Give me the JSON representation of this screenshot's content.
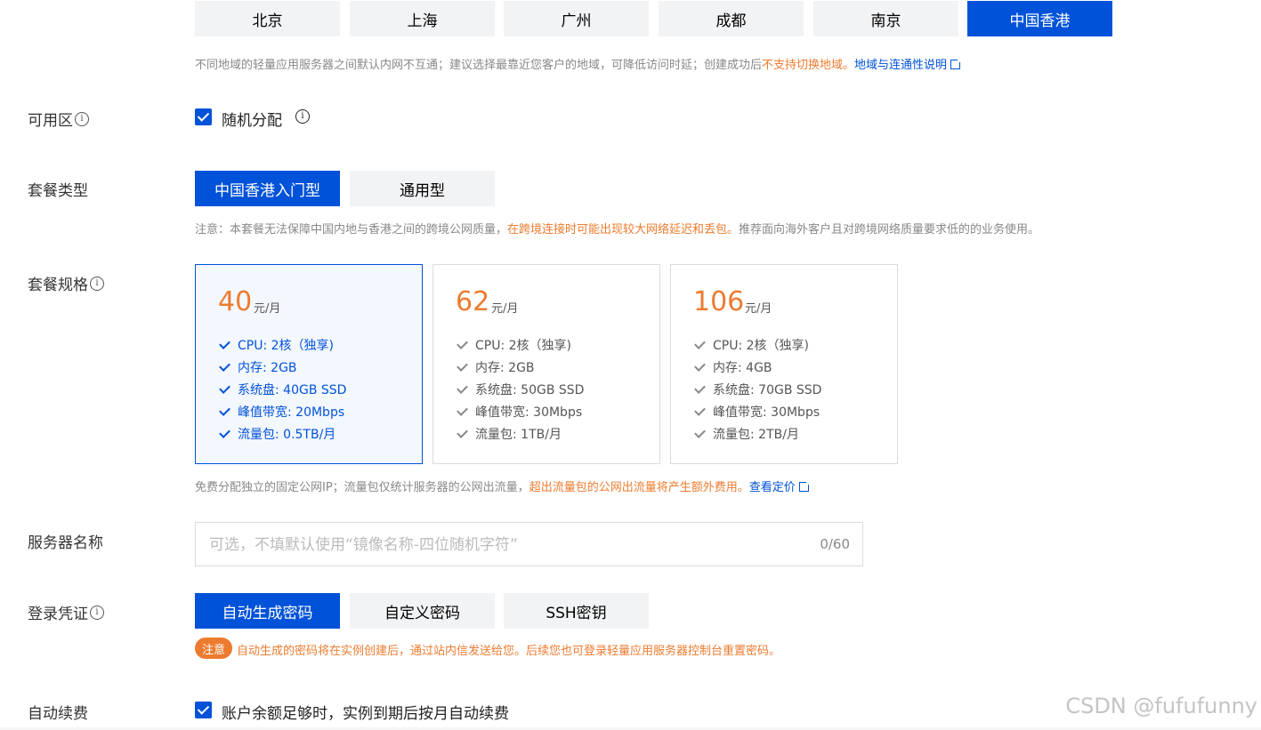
{
  "regions": {
    "items": [
      "北京",
      "上海",
      "广州",
      "成都",
      "南京",
      "中国香港"
    ],
    "selected_index": 5,
    "note_prefix": "不同地域的轻量应用服务器之间默认内网不互通；建议选择最靠近您客户的地域，可降低访问时延；创建成功后",
    "note_warn": "不支持切换地域。",
    "note_link": "地域与连通性说明"
  },
  "availability_zone": {
    "label": "可用区",
    "option": "随机分配",
    "checked": true
  },
  "package_type": {
    "label": "套餐类型",
    "options": [
      "中国香港入门型",
      "通用型"
    ],
    "selected_index": 0,
    "note_prefix": "注意：本套餐无法保障中国内地与香港之间的跨境公网质量，",
    "note_warn": "在跨境连接时可能出现较大网络延迟和丢包。",
    "note_suffix": "推荐面向海外客户且对跨境网络质量要求低的的业务使用。"
  },
  "package_spec": {
    "label": "套餐规格",
    "selected_index": 0,
    "cards": [
      {
        "price": "40",
        "unit": "元/月",
        "specs": [
          "CPU: 2核（独享)",
          "内存: 2GB",
          "系统盘: 40GB SSD",
          "峰值带宽: 20Mbps",
          "流量包: 0.5TB/月"
        ]
      },
      {
        "price": "62",
        "unit": "元/月",
        "specs": [
          "CPU: 2核（独享)",
          "内存: 2GB",
          "系统盘: 50GB SSD",
          "峰值带宽: 30Mbps",
          "流量包: 1TB/月"
        ]
      },
      {
        "price": "106",
        "unit": "元/月",
        "specs": [
          "CPU: 2核（独享)",
          "内存: 4GB",
          "系统盘: 70GB SSD",
          "峰值带宽: 30Mbps",
          "流量包: 2TB/月"
        ]
      }
    ],
    "note_prefix": "免费分配独立的固定公网IP；流量包仅统计服务器的公网出流量，",
    "note_warn": "超出流量包的公网出流量将产生额外费用。",
    "note_link": "查看定价"
  },
  "server_name": {
    "label": "服务器名称",
    "value": "",
    "placeholder": "可选，不填默认使用“镜像名称-四位随机字符”",
    "counter": "0/60"
  },
  "login_credential": {
    "label": "登录凭证",
    "options": [
      "自动生成密码",
      "自定义密码",
      "SSH密钥"
    ],
    "selected_index": 0,
    "tag": "注意",
    "note": "自动生成的密码将在实例创建后，通过站内信发送给您。后续您也可登录轻量应用服务器控制台重置密码。"
  },
  "auto_renew": {
    "label": "自动续费",
    "option": "账户余额足够时，实例到期后按月自动续费",
    "checked": true
  },
  "watermark": "CSDN @fufufunny",
  "colors": {
    "primary": "#0052d9",
    "warning": "#ed7b2f",
    "button_bg": "#f2f3f5"
  }
}
